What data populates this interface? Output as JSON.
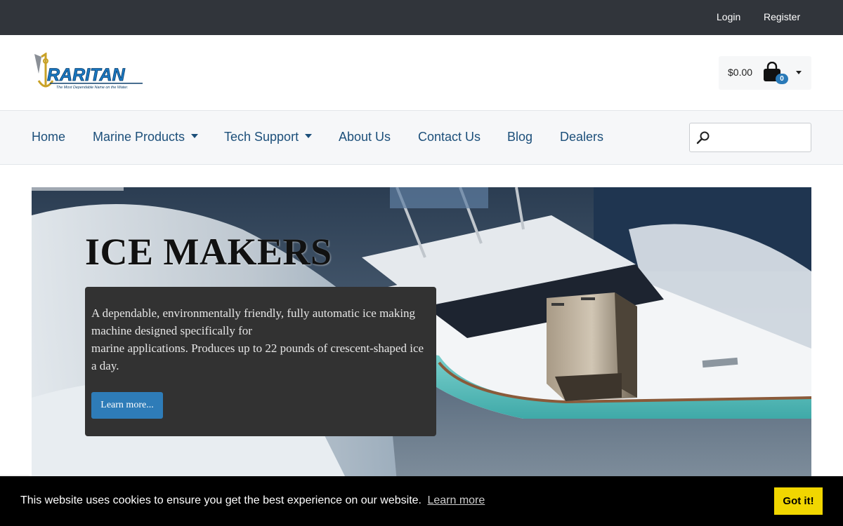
{
  "topbar": {
    "login": "Login",
    "register": "Register"
  },
  "header": {
    "logo_alt": "RARITAN",
    "logo_tagline": "The Most Dependable Name on the Water.",
    "cart_total": "$0.00",
    "cart_count": "0"
  },
  "nav": {
    "items": [
      {
        "label": "Home"
      },
      {
        "label": "Marine Products"
      },
      {
        "label": "Tech Support"
      },
      {
        "label": "About Us"
      },
      {
        "label": "Contact Us"
      },
      {
        "label": "Blog"
      },
      {
        "label": "Dealers"
      }
    ],
    "search_placeholder": ""
  },
  "hero": {
    "title": "ICE MAKERS",
    "text_line1": "A dependable, environmentally friendly, fully automatic ice making machine designed specifically for",
    "text_line2": "marine applications. Produces up to 22 pounds of crescent-shaped ice a day.",
    "button": "Learn more..."
  },
  "cookie": {
    "message": "This website uses cookies to ensure you get the best experience on our website.",
    "link": "Learn more",
    "button": "Got it!"
  },
  "colors": {
    "topbar": "#31353b",
    "nav_link": "#1c4f7a",
    "accent": "#2e7cb8",
    "cookie_button": "#f1d600"
  }
}
